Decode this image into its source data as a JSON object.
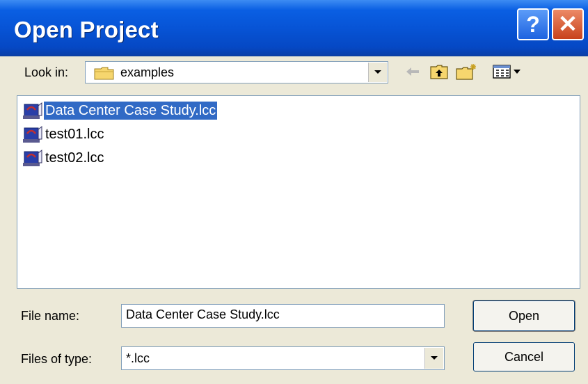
{
  "window": {
    "title": "Open Project",
    "help_label": "?",
    "close_label": "✕"
  },
  "look_in": {
    "label": "Look in:",
    "value": "examples",
    "folder_icon": "folder-icon"
  },
  "toolbar": {
    "back_icon": "back-arrow-icon",
    "up_icon": "up-folder-icon",
    "new_folder_icon": "new-folder-icon",
    "view_menu_icon": "view-menu-icon"
  },
  "files": [
    {
      "name": "Data Center Case Study.lcc",
      "selected": true
    },
    {
      "name": "test01.lcc",
      "selected": false
    },
    {
      "name": "test02.lcc",
      "selected": false
    }
  ],
  "file_name": {
    "label": "File name:",
    "value": "Data Center Case Study.lcc"
  },
  "file_type": {
    "label": "Files of type:",
    "value": "*.lcc"
  },
  "buttons": {
    "open": "Open",
    "cancel": "Cancel"
  },
  "colors": {
    "title_bar": "#0754d6",
    "selection": "#316ac5",
    "dialog_bg": "#ece9d8"
  }
}
